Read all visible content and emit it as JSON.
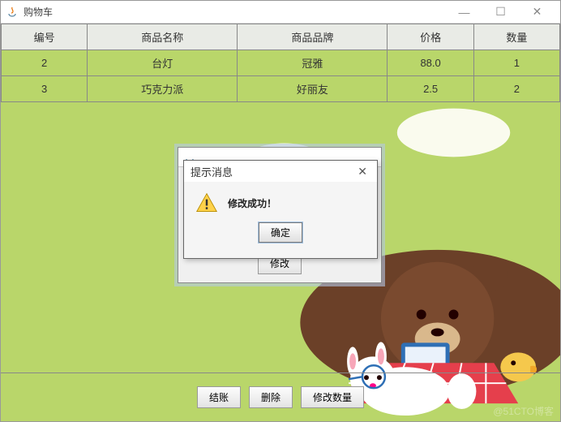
{
  "window": {
    "title": "购物车",
    "min": "—",
    "max": "☐",
    "close": "✕"
  },
  "table": {
    "headers": [
      "编号",
      "商品名称",
      "商品品牌",
      "价格",
      "数量"
    ],
    "rows": [
      [
        "2",
        "台灯",
        "冠雅",
        "88.0",
        "1"
      ],
      [
        "3",
        "巧克力派",
        "好丽友",
        "2.5",
        "2"
      ]
    ]
  },
  "inner_dialog": {
    "title_prefix": "🍵",
    "modify_btn": "修改"
  },
  "alert": {
    "title": "提示消息",
    "message": "修改成功！",
    "ok": "确定",
    "close": "✕"
  },
  "bottom": {
    "checkout": "结账",
    "delete": "删除",
    "modify_qty": "修改数量"
  },
  "watermark": "@51CTO博客"
}
